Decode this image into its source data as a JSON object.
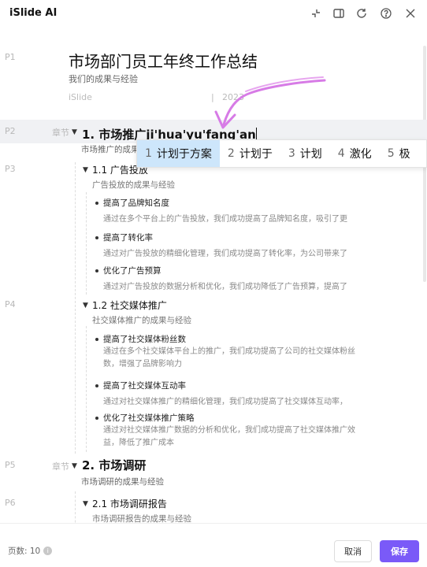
{
  "app": {
    "title": "iSlide AI"
  },
  "toolbar": {
    "icons": [
      "collapse-icon",
      "sidebar-toggle-icon",
      "refresh-icon",
      "help-icon",
      "close-icon"
    ]
  },
  "doc": {
    "title_page": {
      "page": "P1",
      "title": "市场部门员工年终工作总结",
      "subtitle": "我们的成果与经验",
      "author": "iSlide",
      "separator": "|",
      "date_partial": "2023"
    },
    "section1": {
      "page": "P2",
      "tag": "章节",
      "input_text": "1. 市场推广ji'hua'yu'fang'an",
      "desc": "市场推广的成果与经验"
    },
    "ime": {
      "candidates": [
        {
          "num": "1",
          "text": "计划于方案"
        },
        {
          "num": "2",
          "text": "计划于"
        },
        {
          "num": "3",
          "text": "计划"
        },
        {
          "num": "4",
          "text": "激化"
        },
        {
          "num": "5",
          "text": "极"
        }
      ]
    },
    "sub11": {
      "page": "P3",
      "title": "1.1 广告投放",
      "desc": "广告投放的成果与经验",
      "bullets": [
        {
          "title": "提高了品牌知名度",
          "desc": "通过在多个平台上的广告投放，我们成功提高了品牌知名度，吸引了更"
        },
        {
          "title": "提高了转化率",
          "desc": "通过对广告投放的精细化管理，我们成功提高了转化率，为公司带来了"
        },
        {
          "title": "优化了广告预算",
          "desc": "通过对广告投放的数据分析和优化，我们成功降低了广告预算，提高了"
        }
      ]
    },
    "sub12": {
      "page": "P4",
      "title": "1.2 社交媒体推广",
      "desc": "社交媒体推广的成果与经验",
      "bullets": [
        {
          "title": "提高了社交媒体粉丝数",
          "desc": "通过在多个社交媒体平台上的推广，我们成功提高了公司的社交媒体粉丝数，增强了品牌影响力"
        },
        {
          "title": "提高了社交媒体互动率",
          "desc": "通过对社交媒体推广的精细化管理，我们成功提高了社交媒体互动率，"
        },
        {
          "title": "优化了社交媒体推广策略",
          "desc": "通过对社交媒体推广数据的分析和优化，我们成功提高了社交媒体推广效益，降低了推广成本"
        }
      ]
    },
    "section2": {
      "page": "P5",
      "tag": "章节",
      "title": "2. 市场调研",
      "desc": "市场调研的成果与经验"
    },
    "sub21": {
      "page": "P6",
      "title": "2.1 市场调研报告",
      "desc": "市场调研报告的成果与经验"
    }
  },
  "footer": {
    "page_count_label": "页数: 10",
    "info_icon_glyph": "i",
    "cancel_label": "取消",
    "save_label": "保存"
  },
  "colors": {
    "accent": "#7a5af8",
    "ime_selected": "#cde6fb",
    "arrow": "#d77be6",
    "highlight_row": "#f0f1f4"
  }
}
